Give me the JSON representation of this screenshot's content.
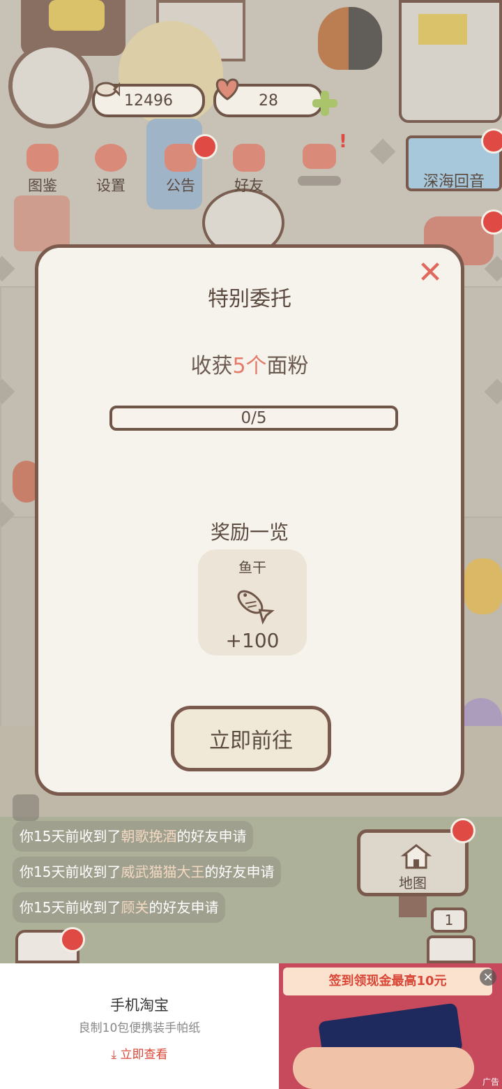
{
  "hud": {
    "fish_count": "12496",
    "heart_count": "28",
    "buttons": [
      "图鉴",
      "设置",
      "公告",
      "好友"
    ],
    "event_label": "深海回音"
  },
  "dialog": {
    "title": "特别委托",
    "task_prefix": "收获",
    "task_highlight": "5个",
    "task_suffix": "面粉",
    "progress_text": "0/5",
    "progress_fraction": 0,
    "rewards_title": "奖励一览",
    "reward_name": "鱼干",
    "reward_amount": "+100",
    "go_button": "立即前往",
    "close_symbol": "✕"
  },
  "messages": [
    {
      "prefix": "你15天前收到了",
      "name": "朝歌挽酒",
      "suffix": "的好友申请"
    },
    {
      "prefix": "你15天前收到了",
      "name": "威武猫猫大王",
      "suffix": "的好友申请"
    },
    {
      "prefix": "你15天前收到了",
      "name": "顾关",
      "suffix": "的好友申请"
    }
  ],
  "map": {
    "label": "地图",
    "counter": "1"
  },
  "ad": {
    "title": "手机淘宝",
    "subtitle": "良制10包便携装手帕纸",
    "cta": "立即查看",
    "banner": "签到领现金最高10元",
    "tag": "广告"
  },
  "colors": {
    "accent": "#e37b68",
    "border": "#7a5a4c",
    "badge": "#e04a45"
  }
}
